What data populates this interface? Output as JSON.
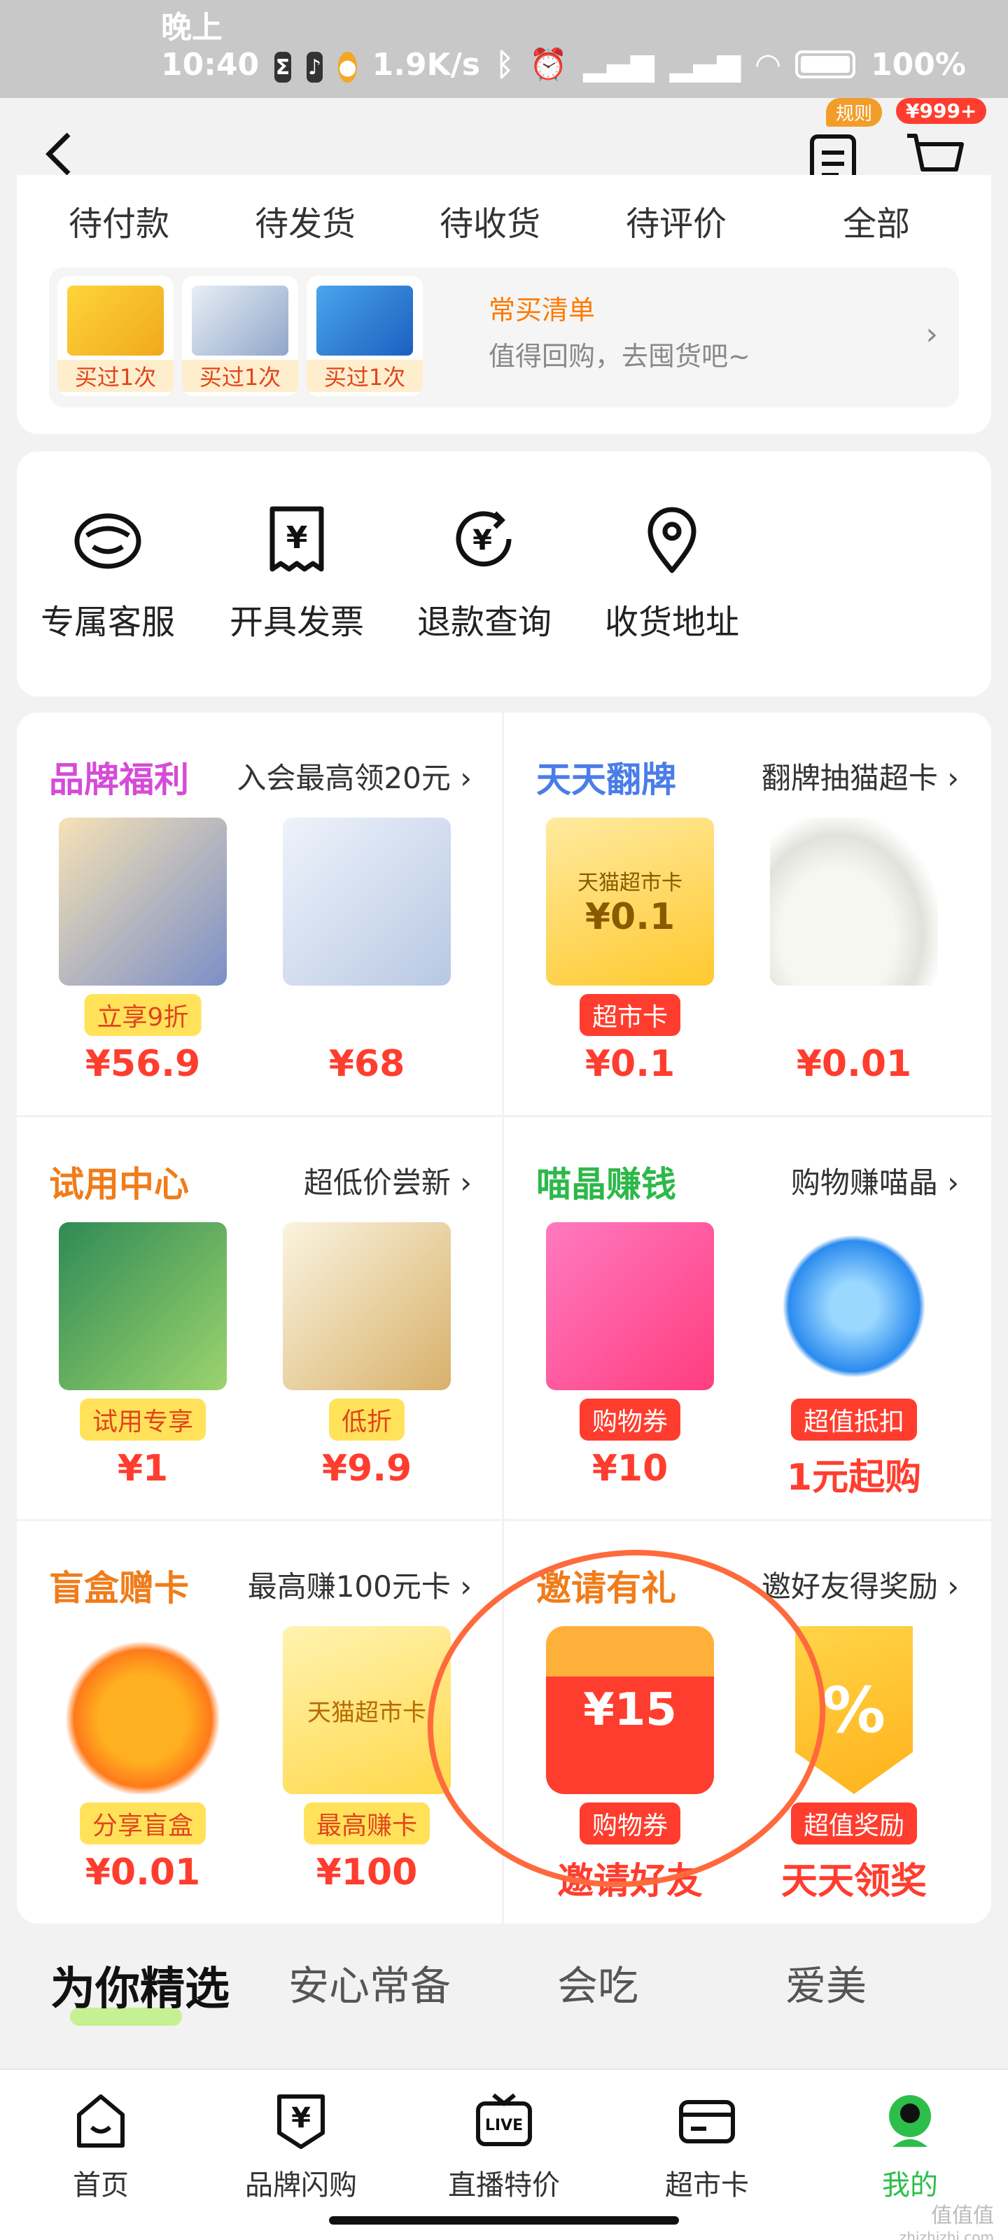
{
  "status_bar": {
    "time": "晚上10:40",
    "net_speed": "1.9K/s",
    "battery": "100%"
  },
  "header": {
    "rules_tag": "规则",
    "cart_count": "¥999+"
  },
  "orders": {
    "tabs": [
      "待付款",
      "待发货",
      "待收货",
      "待评价",
      "全部"
    ],
    "reorder": {
      "bought_labels": [
        "买过1次",
        "买过1次",
        "买过1次"
      ],
      "title": "常买清单",
      "subtitle": "值得回购，去囤货吧~",
      "arrow": "›"
    }
  },
  "services": [
    {
      "label": "专属客服",
      "icon": "customer-service-icon"
    },
    {
      "label": "开具发票",
      "icon": "invoice-icon"
    },
    {
      "label": "退款查询",
      "icon": "refund-icon"
    },
    {
      "label": "收货地址",
      "icon": "location-pin-icon"
    }
  ],
  "promos": [
    {
      "title": "品牌福利",
      "title_color": "#d54bd8",
      "sub": "入会最高领20元 ›",
      "items": [
        {
          "tag": "立享9折",
          "tag_style": "yellow",
          "price": "¥56.9"
        },
        {
          "tag": "",
          "tag_style": "",
          "price": "¥68"
        }
      ]
    },
    {
      "title": "天天翻牌",
      "title_color": "#4a7de8",
      "sub": "翻牌抽猫超卡 ›",
      "items": [
        {
          "tag": "超市卡",
          "tag_style": "red",
          "price": "¥0.1",
          "card_text": "天猫超市卡",
          "card_price": "¥0.1"
        },
        {
          "tag": "",
          "tag_style": "",
          "price": "¥0.01"
        }
      ]
    },
    {
      "title": "试用中心",
      "title_color": "#f07c1a",
      "sub": "超低价尝新 ›",
      "items": [
        {
          "tag": "试用专享",
          "tag_style": "yellow",
          "price": "¥1"
        },
        {
          "tag": "低折",
          "tag_style": "yellow",
          "price": "¥9.9"
        }
      ]
    },
    {
      "title": "喵晶赚钱",
      "title_color": "#2db84a",
      "sub": "购物赚喵晶 ›",
      "items": [
        {
          "tag": "购物券",
          "tag_style": "red",
          "price": "¥10"
        },
        {
          "tag": "超值抵扣",
          "tag_style": "red",
          "price": "1元起购"
        }
      ]
    },
    {
      "title": "盲盒赠卡",
      "title_color": "#f07c1a",
      "sub": "最高赚100元卡 ›",
      "items": [
        {
          "tag": "分享盲盒",
          "tag_style": "yellow",
          "price": "¥0.01"
        },
        {
          "tag": "最高赚卡",
          "tag_style": "yellow",
          "price": "¥100",
          "card_text": "天猫超市卡"
        }
      ]
    },
    {
      "title": "邀请有礼",
      "title_color": "#f07c1a",
      "sub": "邀好友得奖励 ›",
      "items": [
        {
          "tag": "购物券",
          "tag_style": "red",
          "price": "邀请好友",
          "coupon_text": "¥15"
        },
        {
          "tag": "超值奖励",
          "tag_style": "red",
          "price": "天天领奖",
          "coupon_text": "%"
        }
      ]
    }
  ],
  "category_tabs": [
    "为你精选",
    "安心常备",
    "会吃",
    "爱美"
  ],
  "bottom_nav": [
    {
      "label": "首页",
      "icon": "home-icon"
    },
    {
      "label": "品牌闪购",
      "icon": "flash-sale-icon"
    },
    {
      "label": "直播特价",
      "icon": "live-tv-icon"
    },
    {
      "label": "超市卡",
      "icon": "card-icon"
    },
    {
      "label": "我的",
      "icon": "profile-icon"
    }
  ],
  "watermark": "值值值",
  "watermark_url": "zhizhizhi.com"
}
